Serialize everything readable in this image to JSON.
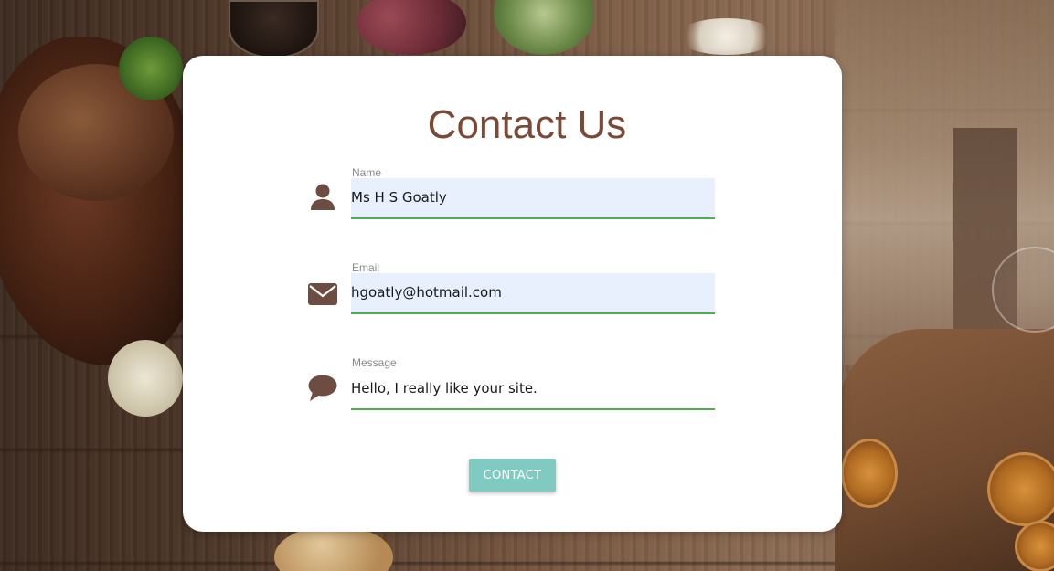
{
  "page": {
    "title": "Contact Us"
  },
  "form": {
    "name": {
      "label": "Name",
      "value": "Ms H S Goatly",
      "icon": "person-icon"
    },
    "email": {
      "label": "Email",
      "value": "hgoatly@hotmail.com",
      "icon": "envelope-icon"
    },
    "message": {
      "label": "Message",
      "value": "Hello, I really like your site.",
      "icon": "speech-bubble-icon"
    },
    "submit_label": "CONTACT"
  },
  "colors": {
    "title": "#7a4a36",
    "icon": "#6d4c41",
    "underline": "#4caf50",
    "autofill_bg": "#e8f0fe",
    "button_bg": "#7fcbc2"
  }
}
